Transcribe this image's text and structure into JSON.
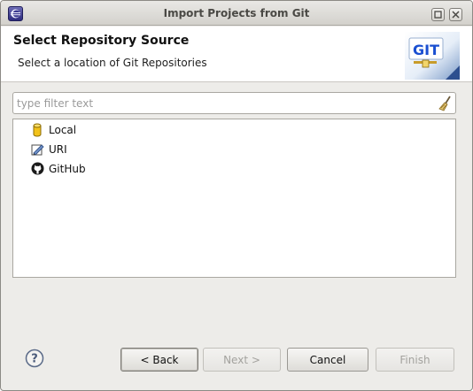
{
  "window": {
    "title": "Import Projects from Git"
  },
  "header": {
    "title": "Select Repository Source",
    "subtitle": "Select a location of Git Repositories",
    "banner_text": "GIT"
  },
  "filter": {
    "placeholder": "type filter text",
    "value": ""
  },
  "sources": [
    {
      "label": "Local",
      "icon": "repository-cylinder-icon"
    },
    {
      "label": "URI",
      "icon": "uri-edit-icon"
    },
    {
      "label": "GitHub",
      "icon": "github-octocat-icon"
    }
  ],
  "buttons": {
    "back": "< Back",
    "next": "Next >",
    "cancel": "Cancel",
    "finish": "Finish"
  },
  "colors": {
    "git_banner_text": "#1a4fd1",
    "local_icon": "#f2c21a"
  }
}
